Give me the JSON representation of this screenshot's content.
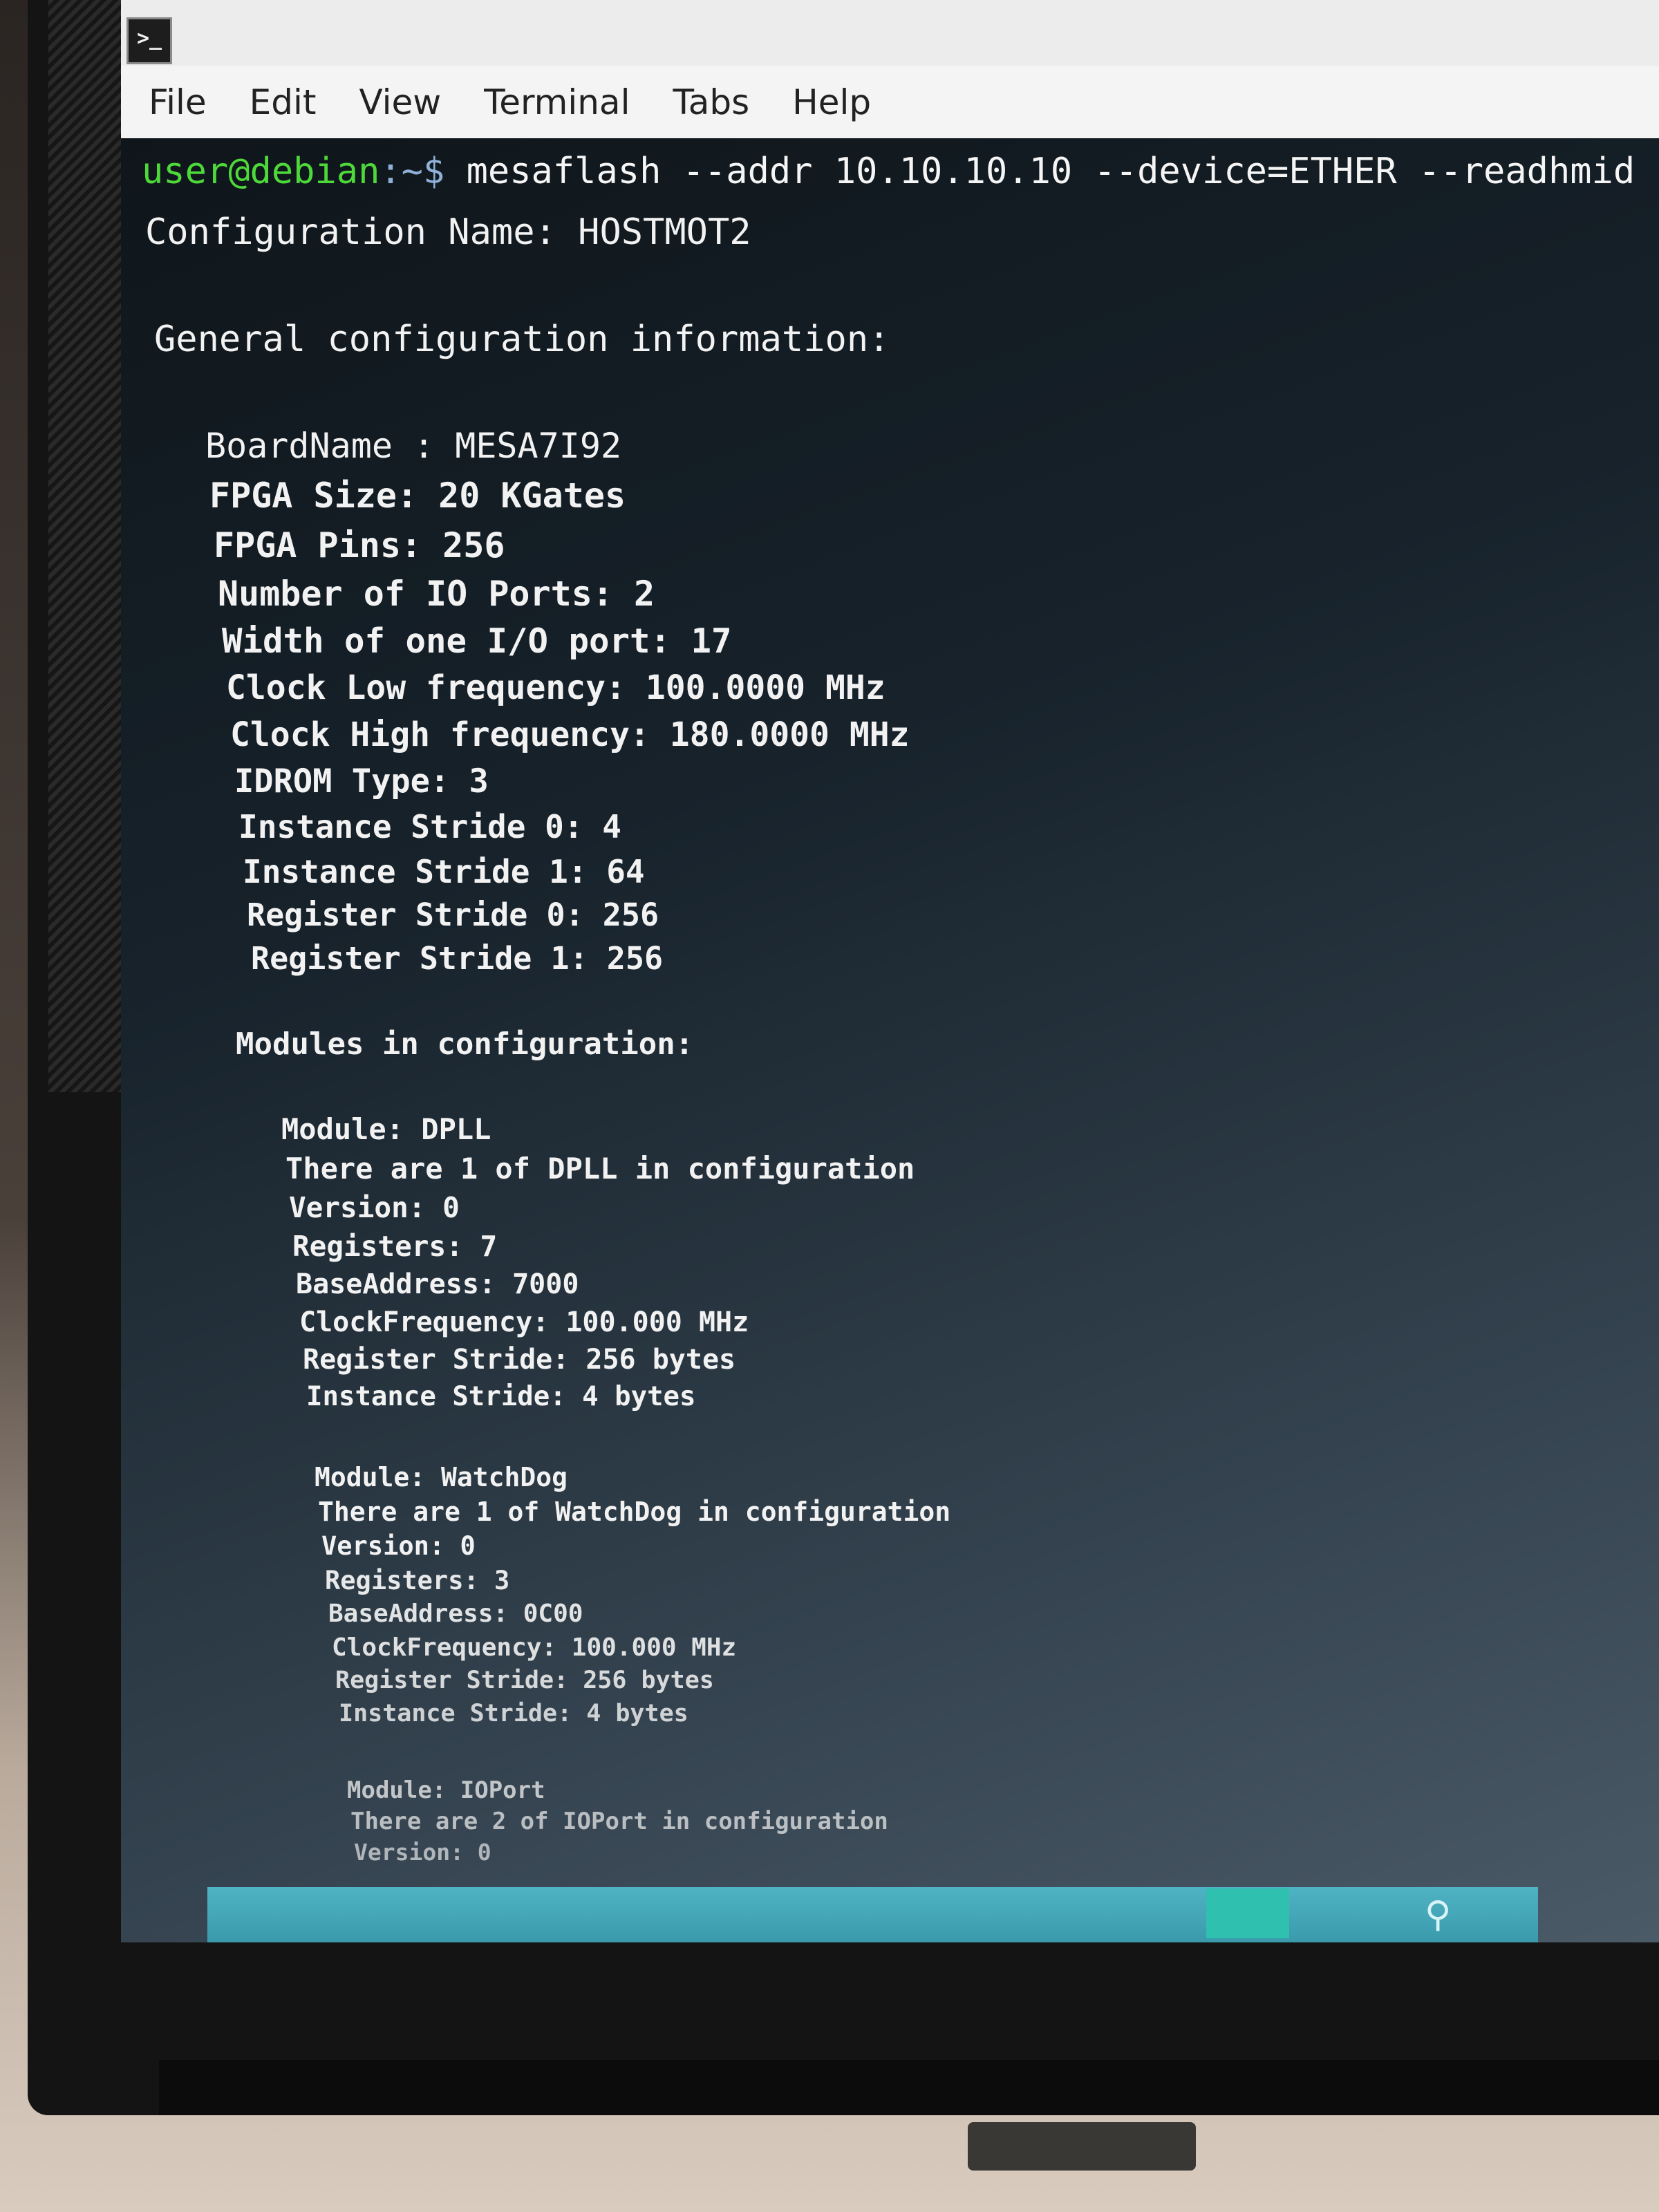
{
  "window": {
    "icon_glyph": ">_"
  },
  "menubar": {
    "items": [
      "File",
      "Edit",
      "View",
      "Terminal",
      "Tabs",
      "Help"
    ]
  },
  "terminal": {
    "prompt_user": "user@debian",
    "prompt_sep": ":~$ ",
    "command": "mesaflash --addr 10.10.10.10 --device=ETHER --readhmid",
    "lines": [
      "Configuration Name: HOSTMOT2",
      "General configuration information:",
      "BoardName : MESA7I92",
      "FPGA Size: 20 KGates",
      "FPGA Pins: 256",
      "Number of IO Ports: 2",
      "Width of one I/O port: 17",
      "Clock Low frequency: 100.0000 MHz",
      "Clock High frequency: 180.0000 MHz",
      "IDROM Type: 3",
      "Instance Stride 0: 4",
      "Instance Stride 1: 64",
      "Register Stride 0: 256",
      "Register Stride 1: 256",
      "Modules in configuration:",
      "Module: DPLL",
      "There are 1 of DPLL in configuration",
      "Version: 0",
      "Registers: 7",
      "BaseAddress: 7000",
      "ClockFrequency: 100.000 MHz",
      "Register Stride: 256 bytes",
      "Instance Stride: 4 bytes",
      "Module: WatchDog",
      "There are 1 of WatchDog in configuration",
      "Version: 0",
      "Registers: 3",
      "BaseAddress: 0C00",
      "ClockFrequency: 100.000 MHz",
      "Register Stride: 256 bytes",
      "Instance Stride: 4 bytes",
      "Module: IOPort",
      "There are 2 of IOPort in configuration",
      "Version: 0"
    ]
  },
  "taskbar": {
    "search_icon": "search-icon"
  },
  "colors": {
    "prompt_user": "#4ed93a",
    "terminal_text": "#f2f2f2",
    "taskbar": "#4fb3c4"
  }
}
